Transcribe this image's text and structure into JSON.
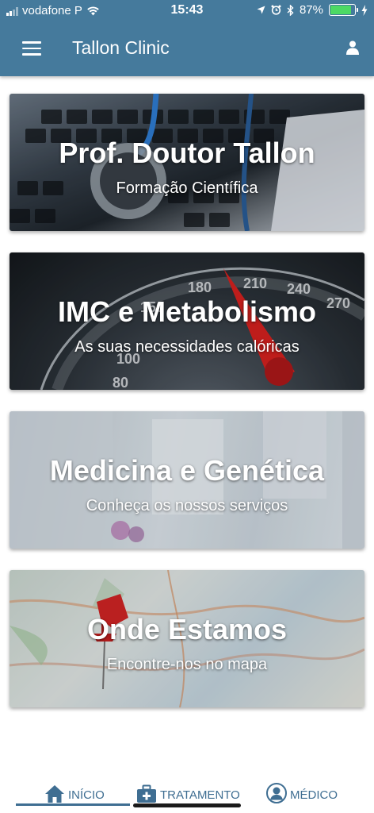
{
  "status": {
    "carrier": "vodafone P",
    "time": "15:43",
    "battery": "87%",
    "battery_level": 0.87
  },
  "header": {
    "title": "Tallon Clinic"
  },
  "cards": [
    {
      "title": "Prof. Doutor Tallon",
      "subtitle": "Formação Científica"
    },
    {
      "title": "IMC e Metabolismo",
      "subtitle": "As suas necessidades calóricas"
    },
    {
      "title": "Medicina e Genética",
      "subtitle": "Conheça os nossos serviços"
    },
    {
      "title": "Onde Estamos",
      "subtitle": "Encontre-nos no mapa"
    }
  ],
  "tabs": [
    {
      "label": "INÍCIO",
      "icon": "home-icon"
    },
    {
      "label": "TRATAMENTO",
      "icon": "medical-kit-icon"
    },
    {
      "label": "MÉDICO",
      "icon": "doctor-avatar-icon"
    }
  ],
  "colors": {
    "header_bg": "#457a9c",
    "accent": "#3f6e92",
    "battery": "#4cd964"
  }
}
